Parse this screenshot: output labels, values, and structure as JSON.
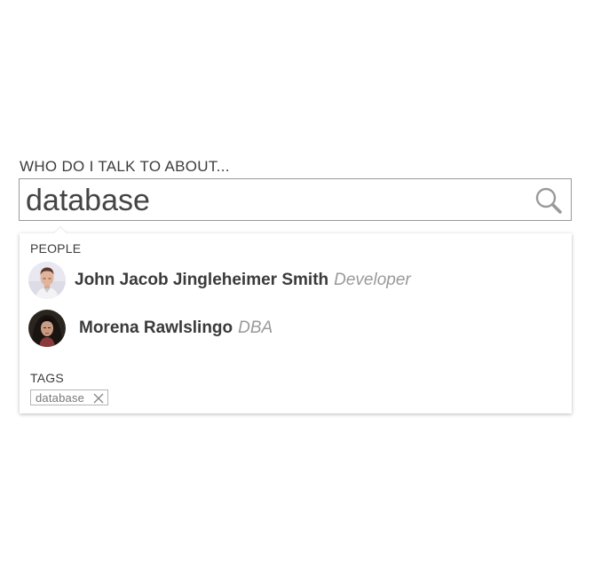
{
  "search": {
    "label": "WHO DO I TALK TO ABOUT...",
    "value": "database",
    "icon": "search-icon"
  },
  "results": {
    "people_title": "PEOPLE",
    "people": [
      {
        "name": "John Jacob Jingleheimer Smith",
        "role": "Developer"
      },
      {
        "name": "Morena Rawlslingo",
        "role": "DBA"
      }
    ],
    "tags_title": "TAGS",
    "tags": [
      {
        "label": "database",
        "remove_icon": "close-icon"
      }
    ]
  },
  "colors": {
    "text": "#333333",
    "muted": "#9a9a9a",
    "border": "#9a9a9a"
  }
}
